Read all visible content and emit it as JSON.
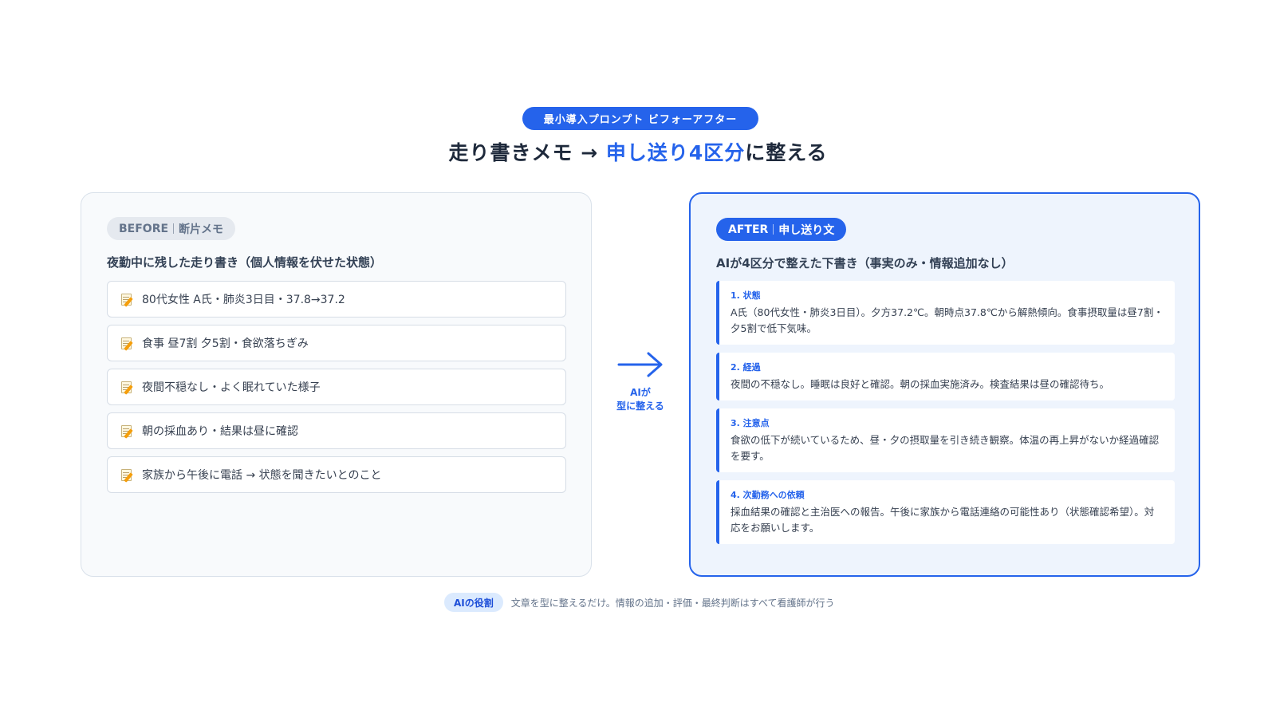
{
  "header": {
    "badge": "最小導入プロンプト ビフォーアフター",
    "title_pre": "走り書きメモ → ",
    "title_accent": "申し送り4区分",
    "title_post": "に整える"
  },
  "before": {
    "tag_en": "BEFORE",
    "tag_jp": "断片メモ",
    "subtitle": "夜勤中に残した走り書き（個人情報を伏せた状態）",
    "icon": "memo-icon",
    "items": [
      "80代女性 A氏・肺炎3日目・37.8→37.2",
      "食事 昼7割 夕5割・食欲落ちぎみ",
      "夜間不穏なし・よく眠れていた様子",
      "朝の採血あり・結果は昼に確認",
      "家族から午後に電話 → 状態を聞きたいとのこと"
    ]
  },
  "arrow": {
    "icon": "arrow-right-icon",
    "label_line1": "AIが",
    "label_line2": "型に整える"
  },
  "after": {
    "tag_en": "AFTER",
    "tag_jp": "申し送り文",
    "subtitle": "AIが4区分で整えた下書き（事実のみ・情報追加なし）",
    "sections": [
      {
        "title": "1. 状態",
        "body": "A氏（80代女性・肺炎3日目）。夕方37.2℃。朝時点37.8℃から解熱傾向。食事摂取量は昼7割・夕5割で低下気味。"
      },
      {
        "title": "2. 経過",
        "body": "夜間の不穏なし。睡眠は良好と確認。朝の採血実施済み。検査結果は昼の確認待ち。"
      },
      {
        "title": "3. 注意点",
        "body": "食欲の低下が続いているため、昼・夕の摂取量を引き続き観察。体温の再上昇がないか経過確認を要す。"
      },
      {
        "title": "4. 次勤務への依頼",
        "body": "採血結果の確認と主治医への報告。午後に家族から電話連絡の可能性あり（状態確認希望）。対応をお願いします。"
      }
    ]
  },
  "footer": {
    "badge": "AIの役割",
    "text": "文章を型に整えるだけ。情報の追加・評価・最終判断はすべて看護師が行う"
  },
  "colors": {
    "accent": "#2563eb",
    "before_bg": "#f8fafc",
    "after_bg": "#eef4fd"
  }
}
